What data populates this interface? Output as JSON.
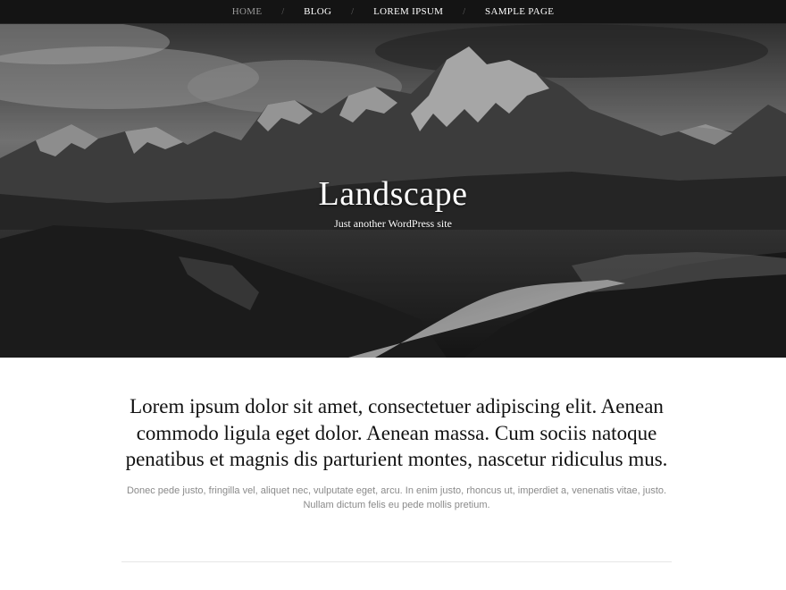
{
  "nav": {
    "items": [
      {
        "label": "HOME",
        "current": true
      },
      {
        "label": "BLOG",
        "current": false
      },
      {
        "label": "LOREM IPSUM",
        "current": false
      },
      {
        "label": "SAMPLE PAGE",
        "current": false
      }
    ],
    "separator": "/"
  },
  "header": {
    "site_title": "Landscape",
    "tagline": "Just another WordPress site",
    "image": "black-and-white mountain range with river valley"
  },
  "post": {
    "lead": "Lorem ipsum dolor sit amet, consectetuer adipiscing elit. Aenean commodo ligula eget dolor. Aenean massa. Cum sociis natoque penatibus et magnis dis parturient montes, nascetur ridiculus mus.",
    "body": "Donec pede justo, fringilla vel, aliquet nec, vulputate eget, arcu. In enim justo, rhoncus ut, imperdiet a, venenatis vitae, justo. Nullam dictum felis eu pede mollis pretium."
  },
  "colors": {
    "nav_bg": "#141414",
    "nav_current": "#9a9a9a",
    "text_dark": "#111111",
    "text_muted": "#8a8a8a"
  }
}
